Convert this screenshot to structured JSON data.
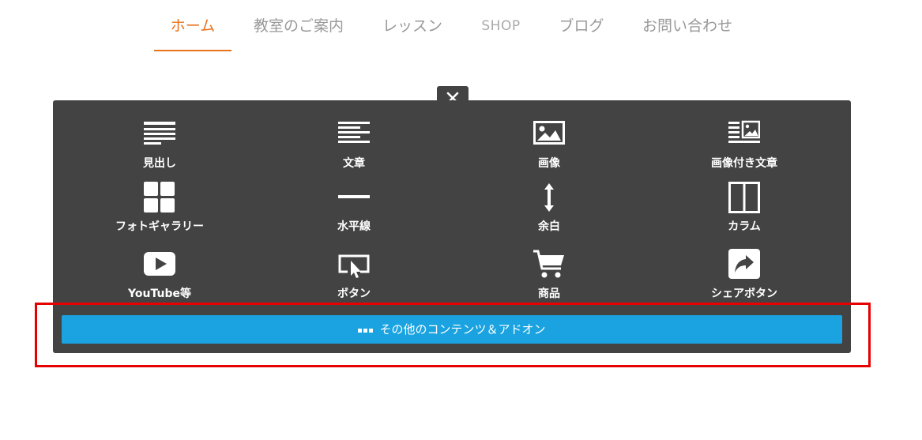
{
  "nav": {
    "items": [
      {
        "label": "ホーム",
        "active": true
      },
      {
        "label": "教室のご案内",
        "active": false
      },
      {
        "label": "レッスン",
        "active": false
      },
      {
        "label": "SHOP",
        "active": false
      },
      {
        "label": "ブログ",
        "active": false
      },
      {
        "label": "お問い合わせ",
        "active": false
      }
    ],
    "accent_color": "#e8731d"
  },
  "panel": {
    "close_icon": "close-icon",
    "tiles": [
      {
        "label": "見出し",
        "icon": "heading-icon"
      },
      {
        "label": "文章",
        "icon": "text-icon"
      },
      {
        "label": "画像",
        "icon": "image-icon"
      },
      {
        "label": "画像付き文章",
        "icon": "image-text-icon"
      },
      {
        "label": "フォトギャラリー",
        "icon": "photo-gallery-icon"
      },
      {
        "label": "水平線",
        "icon": "horizontal-rule-icon"
      },
      {
        "label": "余白",
        "icon": "spacing-icon"
      },
      {
        "label": "カラム",
        "icon": "columns-icon"
      },
      {
        "label": "YouTube等",
        "icon": "youtube-icon"
      },
      {
        "label": "ボタン",
        "icon": "button-icon"
      },
      {
        "label": "商品",
        "icon": "cart-icon"
      },
      {
        "label": "シェアボタン",
        "icon": "share-icon"
      }
    ],
    "more_button": {
      "label": "その他のコンテンツ＆アドオン",
      "icon": "more-dots-icon",
      "color": "#1aa3e0"
    },
    "background": "#434343"
  },
  "highlight": {
    "color": "#e60000"
  }
}
